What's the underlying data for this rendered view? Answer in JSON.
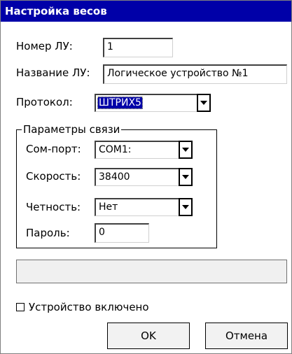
{
  "window": {
    "title": "Настройка весов"
  },
  "form": {
    "lu_number_label": "Номер ЛУ:",
    "lu_number_value": "1",
    "lu_name_label": "Название ЛУ:",
    "lu_name_value": "Логическое устройство №1",
    "protocol_label": "Протокол:",
    "protocol_value": "ШТРИХ5"
  },
  "connection": {
    "group_title": "Параметры связи",
    "com_port_label": "Сом-порт:",
    "com_port_value": "COM1:",
    "speed_label": "Скорость:",
    "speed_value": "38400",
    "parity_label": "Четность:",
    "parity_value": "Нет",
    "password_label": "Пароль:",
    "password_value": "0"
  },
  "status": {
    "text": ""
  },
  "device": {
    "enabled_label": "Устройство включено",
    "enabled": false
  },
  "buttons": {
    "ok": "OK",
    "cancel": "Отмена"
  },
  "colors": {
    "title_bar": "#0000a8",
    "selection": "#0000a8",
    "background": "#ffffff"
  }
}
